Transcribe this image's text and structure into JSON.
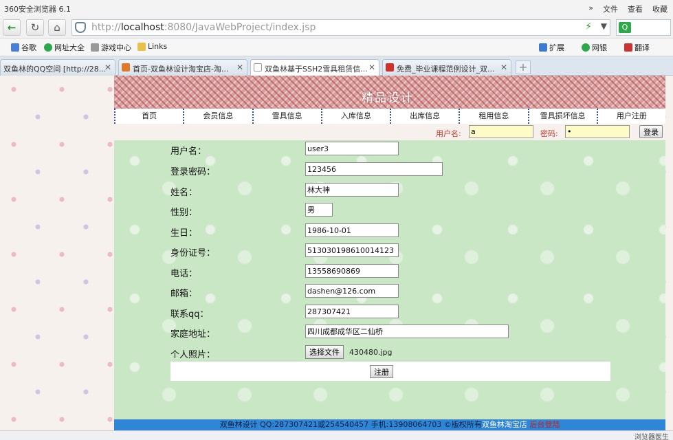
{
  "browser": {
    "title": "360安全浏览器 6.1",
    "menus": [
      "»",
      "文件",
      "查看",
      "收藏"
    ],
    "url_prefix": "http://",
    "url_host": "localhost",
    "url_rest": ":8080/JavaWebProject/index.jsp",
    "favorites": [
      "谷歌",
      "网址大全",
      "游戏中心",
      "Links"
    ],
    "right_tools": [
      "扩展",
      "网银",
      "翻译"
    ],
    "tabs": [
      {
        "label": "双鱼林的QQ空间 [http://28...",
        "active": false
      },
      {
        "label": "首页-双鱼林设计淘宝店-淘...",
        "active": false
      },
      {
        "label": "双鱼林基于SSH2雪具租赁信...",
        "active": true
      },
      {
        "label": "免费_毕业课程范例设计_双...",
        "active": false
      }
    ],
    "status_text": "浏览器医生"
  },
  "site": {
    "banner_slogan": "精品设计",
    "nav": [
      "首页",
      "会员信息",
      "雪具信息",
      "入库信息",
      "出库信息",
      "租用信息",
      "雪具损坏信息",
      "用户注册"
    ],
    "login": {
      "username_label": "用户名:",
      "username_value": "a",
      "password_label": "密码:",
      "password_value": "•",
      "button": "登录"
    }
  },
  "form": {
    "fields": [
      {
        "label": "用户名：",
        "value": "user3"
      },
      {
        "label": "登录密码：",
        "value": "123456"
      },
      {
        "label": "姓名：",
        "value": "林大神"
      },
      {
        "label": "性别：",
        "value": "男"
      },
      {
        "label": "生日：",
        "value": "1986-10-01"
      },
      {
        "label": "身份证号：",
        "value": "513030198610014123"
      },
      {
        "label": "电话：",
        "value": "13558690869"
      },
      {
        "label": "邮箱：",
        "value": "dashen@126.com"
      },
      {
        "label": "联系qq：",
        "value": "287307421"
      },
      {
        "label": "家庭地址：",
        "value": "四川成都成华区二仙桥"
      }
    ],
    "photo_label": "个人照片：",
    "file_button": "选择文件",
    "file_name": "430480.jpg",
    "submit": "注册"
  },
  "footer": {
    "text": "双鱼林设计 QQ:287307421或254540457 手机:13908064703 ©版权所有",
    "shop_link": "双鱼林淘宝店",
    "admin_link": "后台登陆"
  }
}
